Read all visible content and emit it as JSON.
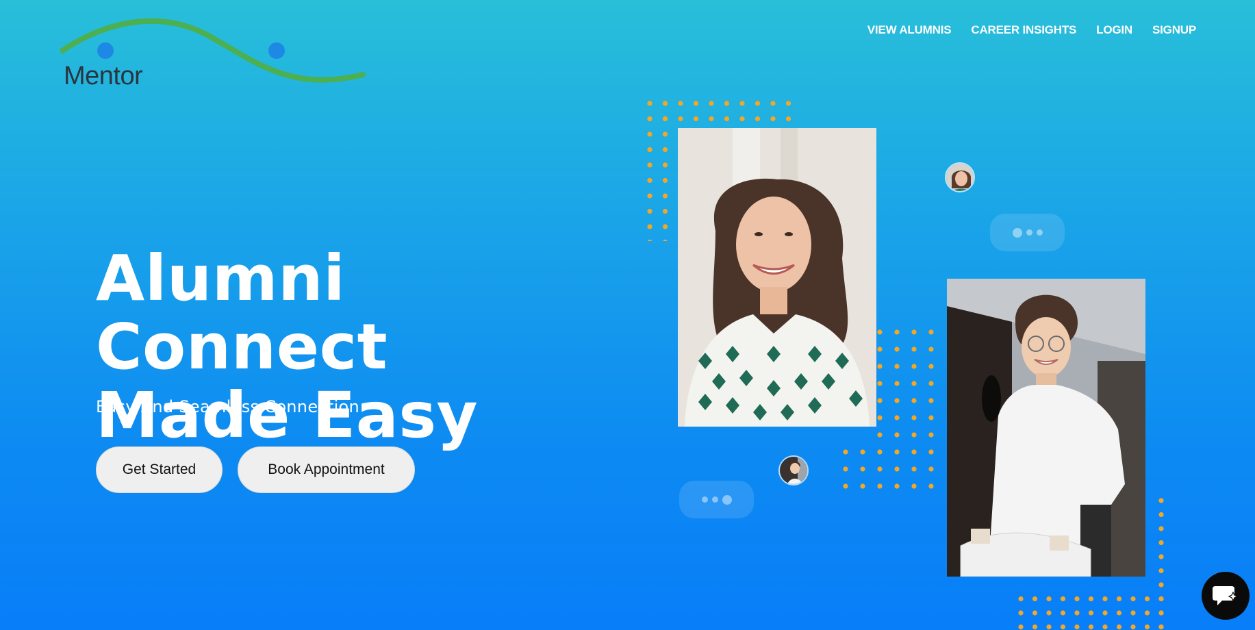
{
  "brand": {
    "name": "Mentor"
  },
  "nav": {
    "items": [
      {
        "label": "VIEW ALUMNIS"
      },
      {
        "label": "CAREER INSIGHTS"
      },
      {
        "label": "LOGIN"
      },
      {
        "label": "SIGNUP"
      }
    ]
  },
  "hero": {
    "title_line1": "Alumni Connect",
    "title_line2": "Made Easy",
    "subtitle": "Easy And Seamless Connection",
    "primary_button": "Get Started",
    "secondary_button": "Book Appointment"
  },
  "colors": {
    "accent_dots": "#f5a623",
    "logo_wave": "#4caf50",
    "logo_dot": "#1e88e5",
    "button_bg": "#efefef"
  },
  "icons": {
    "chat": "chat-support-icon"
  }
}
